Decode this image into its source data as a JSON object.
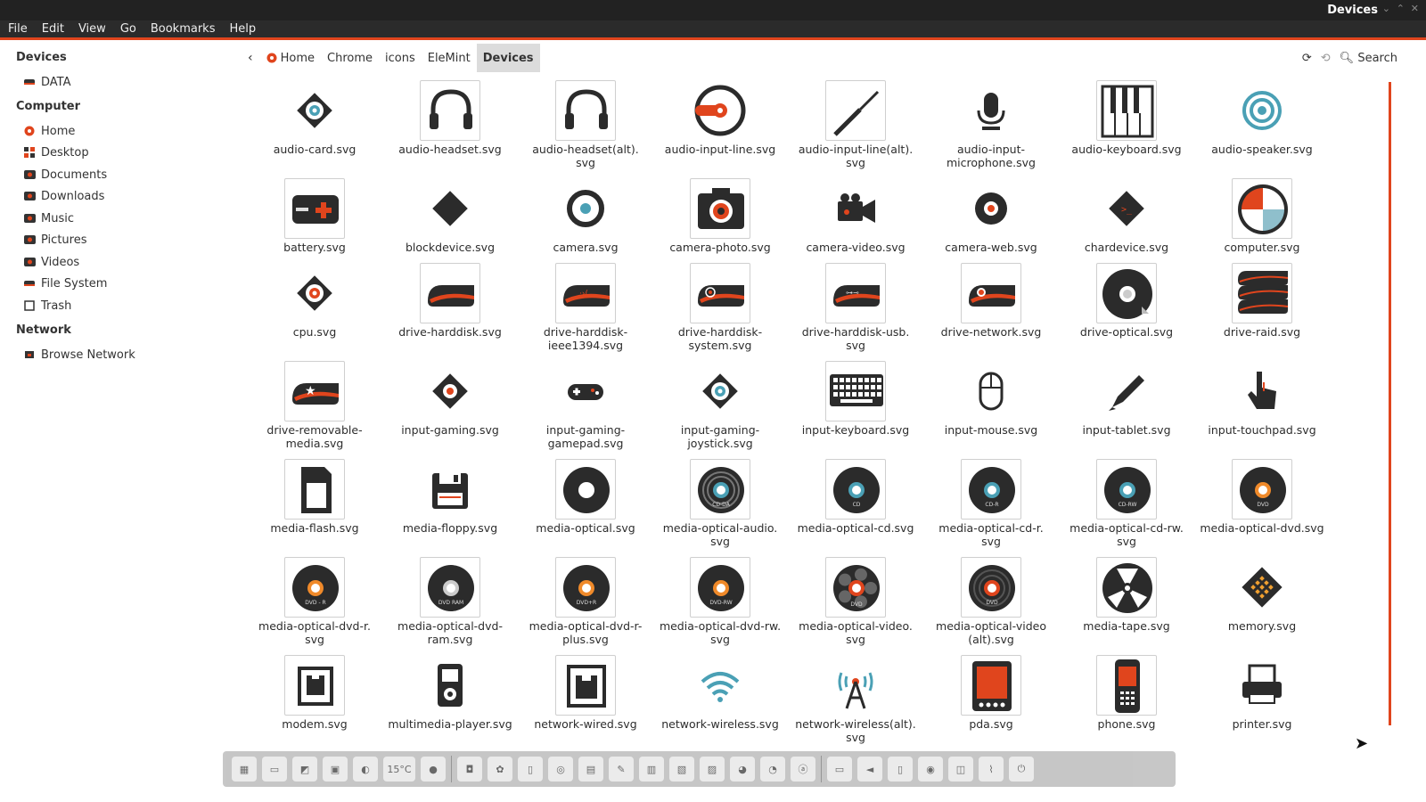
{
  "window": {
    "title": "Devices"
  },
  "menu": [
    "File",
    "Edit",
    "View",
    "Go",
    "Bookmarks",
    "Help"
  ],
  "sidebar": {
    "sections": [
      {
        "header": "Devices",
        "items": [
          {
            "label": "DATA",
            "icon": "drive-icon"
          }
        ]
      },
      {
        "header": "Computer",
        "items": [
          {
            "label": "Home",
            "icon": "home-icon"
          },
          {
            "label": "Desktop",
            "icon": "desktop-icon"
          },
          {
            "label": "Documents",
            "icon": "documents-icon"
          },
          {
            "label": "Downloads",
            "icon": "downloads-icon"
          },
          {
            "label": "Music",
            "icon": "music-icon"
          },
          {
            "label": "Pictures",
            "icon": "pictures-icon"
          },
          {
            "label": "Videos",
            "icon": "videos-icon"
          },
          {
            "label": "File System",
            "icon": "filesystem-icon"
          },
          {
            "label": "Trash",
            "icon": "trash-icon"
          }
        ]
      },
      {
        "header": "Network",
        "items": [
          {
            "label": "Browse Network",
            "icon": "network-icon"
          }
        ]
      }
    ]
  },
  "pathbar": {
    "crumbs": [
      "Home",
      "Chrome",
      "icons",
      "EleMint",
      "Devices"
    ],
    "active": "Devices"
  },
  "toolbar": {
    "search_label": "Search"
  },
  "accent": "#e0451d",
  "files": [
    [
      "audio-card.svg",
      "audio-headset.svg",
      "audio-headset(alt).svg",
      "audio-input-line.svg",
      "audio-input-line(alt).svg",
      "audio-input-microphone.svg",
      "audio-keyboard.svg",
      "audio-speaker.svg"
    ],
    [
      "battery.svg",
      "blockdevice.svg",
      "camera.svg",
      "camera-photo.svg",
      "camera-video.svg",
      "camera-web.svg",
      "chardevice.svg",
      "computer.svg"
    ],
    [
      "cpu.svg",
      "drive-harddisk.svg",
      "drive-harddisk-ieee1394.svg",
      "drive-harddisk-system.svg",
      "drive-harddisk-usb.svg",
      "drive-network.svg",
      "drive-optical.svg",
      "drive-raid.svg"
    ],
    [
      "drive-removable-media.svg",
      "input-gaming.svg",
      "input-gaming-gamepad.svg",
      "input-gaming-joystick.svg",
      "input-keyboard.svg",
      "input-mouse.svg",
      "input-tablet.svg",
      "input-touchpad.svg"
    ],
    [
      "media-flash.svg",
      "media-floppy.svg",
      "media-optical.svg",
      "media-optical-audio.svg",
      "media-optical-cd.svg",
      "media-optical-cd-r.svg",
      "media-optical-cd-rw.svg",
      "media-optical-dvd.svg"
    ],
    [
      "media-optical-dvd-r.svg",
      "media-optical-dvd-ram.svg",
      "media-optical-dvd-r-plus.svg",
      "media-optical-dvd-rw.svg",
      "media-optical-video.svg",
      "media-optical-video(alt).svg",
      "media-tape.svg",
      "memory.svg"
    ],
    [
      "modem.svg",
      "multimedia-player.svg",
      "network-wired.svg",
      "network-wireless.svg",
      "network-wireless(alt).svg",
      "pda.svg",
      "phone.svg",
      "printer.svg"
    ]
  ],
  "file_label_lines": [
    [
      [
        "audio-card.svg"
      ],
      [
        "audio-headset.svg"
      ],
      [
        "audio-headset(alt).",
        "svg"
      ],
      [
        "audio-input-line.svg"
      ],
      [
        "audio-input-line(alt).",
        "svg"
      ],
      [
        "audio-input-",
        "microphone.svg"
      ],
      [
        "audio-keyboard.svg"
      ],
      [
        "audio-speaker.svg"
      ]
    ],
    [
      [
        "battery.svg"
      ],
      [
        "blockdevice.svg"
      ],
      [
        "camera.svg"
      ],
      [
        "camera-photo.svg"
      ],
      [
        "camera-video.svg"
      ],
      [
        "camera-web.svg"
      ],
      [
        "chardevice.svg"
      ],
      [
        "computer.svg"
      ]
    ],
    [
      [
        "cpu.svg"
      ],
      [
        "drive-harddisk.svg"
      ],
      [
        "drive-harddisk-",
        "ieee1394.svg"
      ],
      [
        "drive-harddisk-",
        "system.svg"
      ],
      [
        "drive-harddisk-usb.",
        "svg"
      ],
      [
        "drive-network.svg"
      ],
      [
        "drive-optical.svg"
      ],
      [
        "drive-raid.svg"
      ]
    ],
    [
      [
        "drive-removable-",
        "media.svg"
      ],
      [
        "input-gaming.svg"
      ],
      [
        "input-gaming-",
        "gamepad.svg"
      ],
      [
        "input-gaming-",
        "joystick.svg"
      ],
      [
        "input-keyboard.svg"
      ],
      [
        "input-mouse.svg"
      ],
      [
        "input-tablet.svg"
      ],
      [
        "input-touchpad.svg"
      ]
    ],
    [
      [
        "media-flash.svg"
      ],
      [
        "media-floppy.svg"
      ],
      [
        "media-optical.svg"
      ],
      [
        "media-optical-audio.",
        "svg"
      ],
      [
        "media-optical-cd.svg"
      ],
      [
        "media-optical-cd-r.",
        "svg"
      ],
      [
        "media-optical-cd-rw.",
        "svg"
      ],
      [
        "media-optical-dvd.svg"
      ]
    ],
    [
      [
        "media-optical-dvd-r.",
        "svg"
      ],
      [
        "media-optical-dvd-",
        "ram.svg"
      ],
      [
        "media-optical-dvd-r-",
        "plus.svg"
      ],
      [
        "media-optical-dvd-rw.",
        "svg"
      ],
      [
        "media-optical-video.",
        "svg"
      ],
      [
        "media-optical-video",
        "(alt).svg"
      ],
      [
        "media-tape.svg"
      ],
      [
        "memory.svg"
      ]
    ],
    [
      [
        "modem.svg"
      ],
      [
        "multimedia-player.svg"
      ],
      [
        "network-wired.svg"
      ],
      [
        "network-wireless.svg"
      ],
      [
        "network-wireless(alt).",
        "svg"
      ],
      [
        "pda.svg"
      ],
      [
        "phone.svg"
      ],
      [
        "printer.svg"
      ]
    ]
  ],
  "disc_badges": {
    "media-optical-audio.svg": "CD-DA",
    "media-optical-cd.svg": "CD",
    "media-optical-cd-r.svg": "CD-R",
    "media-optical-cd-rw.svg": "CD-RW",
    "media-optical-dvd.svg": "DVD",
    "media-optical-dvd-r.svg": "DVD - R",
    "media-optical-dvd-ram.svg": "DVD RAM",
    "media-optical-dvd-r-plus.svg": "DVD+R",
    "media-optical-dvd-rw.svg": "DVD-RW",
    "media-optical-video.svg": "DVD",
    "media-optical-video(alt).svg": "DVD"
  },
  "dock": {
    "weather": "15°C"
  }
}
